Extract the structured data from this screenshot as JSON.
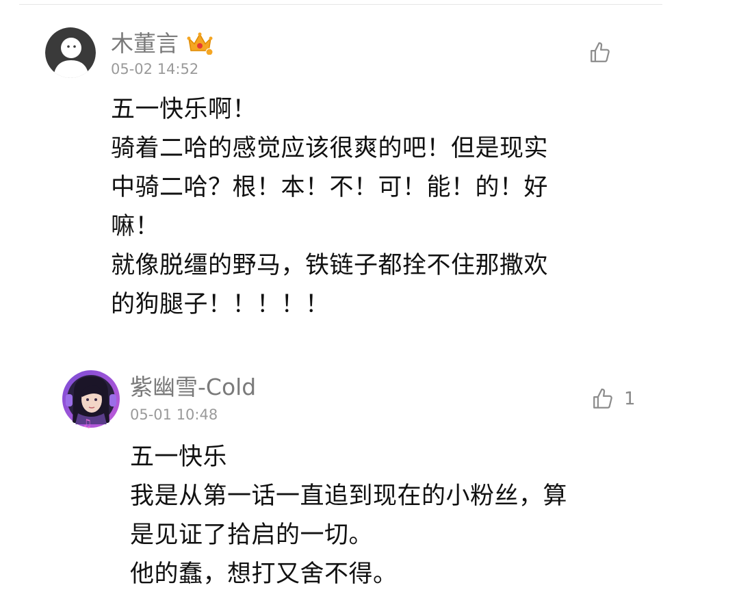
{
  "comments": [
    {
      "username": "木董言",
      "timestamp": "05-02 14:52",
      "like_count": "",
      "badge": "crown-badge",
      "avatar": "default-avatar",
      "lines": [
        "五一快乐啊！",
        "骑着二哈的感觉应该很爽的吧！但是现实",
        "中骑二哈？根！本！不！可！能！的！好",
        "嘛！",
        "就像脱缰的野马，铁链子都拴不住那撒欢",
        "的狗腿子！！！！！"
      ]
    },
    {
      "username": "紫幽雪-Cold",
      "timestamp": "05-01 10:48",
      "like_count": "1",
      "avatar": "anime-girl-avatar",
      "lines": [
        "五一快乐",
        "我是从第一话一直追到现在的小粉丝，算",
        "是见证了拾启的一切。",
        "他的蠢，想打又舍不得。"
      ]
    }
  ],
  "colors": {
    "username": "#7a7a7a",
    "timestamp": "#9a9a9a",
    "body": "#111111",
    "icon": "#8c8c8c",
    "crown": "#f5a623"
  }
}
